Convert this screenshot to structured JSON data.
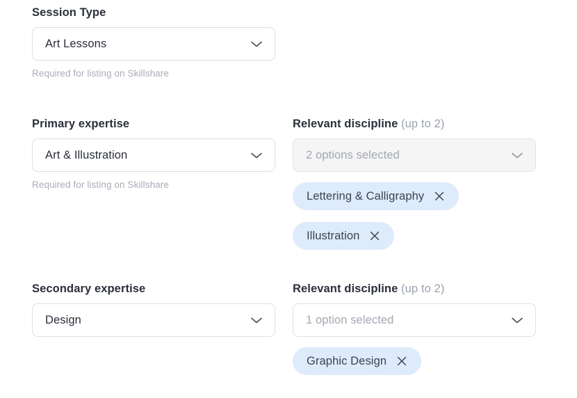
{
  "theme": {
    "page_background": "#ffffff",
    "label_color": "#2b2f3a",
    "muted_color": "#9ba1ae",
    "helper_color": "#a8adb8",
    "field_border": "#dcdfe3",
    "field_filled_background": "#f5f5f6",
    "chip_background": "#ddebfb",
    "chip_text": "#3e4350"
  },
  "form": {
    "session_type": {
      "label": "Session Type",
      "value": "Art Lessons",
      "chevron_icon": "chevron-down-icon",
      "helper": "Required for listing on Skillshare"
    },
    "primary_expertise": {
      "label": "Primary expertise",
      "value": "Art & Illustration",
      "chevron_icon": "chevron-down-icon",
      "helper": "Required for listing on Skillshare"
    },
    "primary_discipline": {
      "label": "Relevant discipline",
      "label_suffix": "(up to 2)",
      "value": "2 options selected",
      "chevron_icon": "chevron-down-icon",
      "chips": [
        {
          "label": "Lettering & Calligraphy",
          "remove_icon": "close-icon"
        },
        {
          "label": "Illustration",
          "remove_icon": "close-icon"
        }
      ]
    },
    "secondary_expertise": {
      "label": "Secondary expertise",
      "value": "Design",
      "chevron_icon": "chevron-down-icon"
    },
    "secondary_discipline": {
      "label": "Relevant discipline",
      "label_suffix": "(up to 2)",
      "value": "1 option selected",
      "chevron_icon": "chevron-down-icon",
      "chips": [
        {
          "label": "Graphic Design",
          "remove_icon": "close-icon"
        }
      ]
    }
  }
}
